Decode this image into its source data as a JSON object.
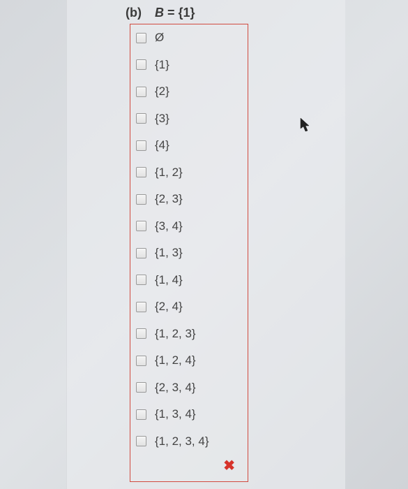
{
  "question": {
    "part_label": "(b)",
    "prompt_prefix": "B",
    "prompt_eq": " = ",
    "prompt_set": "{1}"
  },
  "options": [
    {
      "label": "Ø"
    },
    {
      "label": "{1}"
    },
    {
      "label": "{2}"
    },
    {
      "label": "{3}"
    },
    {
      "label": "{4}"
    },
    {
      "label": "{1, 2}"
    },
    {
      "label": "{2, 3}"
    },
    {
      "label": "{3, 4}"
    },
    {
      "label": "{1, 3}"
    },
    {
      "label": "{1, 4}"
    },
    {
      "label": "{2, 4}"
    },
    {
      "label": "{1, 2, 3}"
    },
    {
      "label": "{1, 2, 4}"
    },
    {
      "label": "{2, 3, 4}"
    },
    {
      "label": "{1, 3, 4}"
    },
    {
      "label": "{1, 2, 3, 4}"
    }
  ],
  "feedback": {
    "mark": "✖"
  }
}
